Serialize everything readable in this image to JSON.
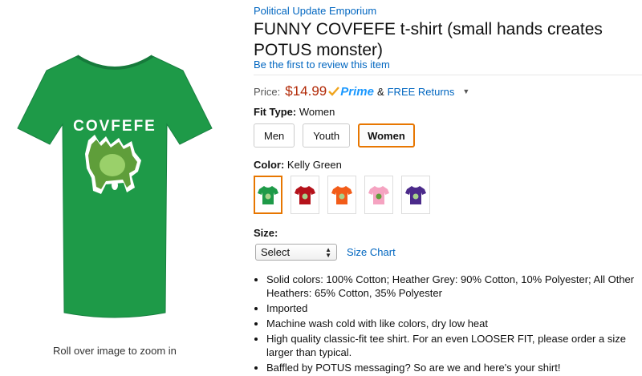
{
  "product": {
    "brand": "Political Update Emporium",
    "title": "FUNNY COVFEFE t-shirt (small hands creates POTUS monster)",
    "review_link": "Be the first to review this item",
    "shirt_text": "COVFEFE",
    "zoom_hint": "Roll over image to zoom in"
  },
  "price": {
    "label": "Price:",
    "value": "$14.99",
    "prime": "Prime",
    "amp": "&",
    "free_returns": "FREE Returns"
  },
  "fit": {
    "label": "Fit Type:",
    "selected": "Women",
    "options": [
      "Men",
      "Youth",
      "Women"
    ]
  },
  "color": {
    "label": "Color:",
    "selected": "Kelly Green",
    "swatches": [
      {
        "name": "Kelly Green",
        "hex": "#1e9a48"
      },
      {
        "name": "Red",
        "hex": "#b5121b"
      },
      {
        "name": "Orange",
        "hex": "#f25c19"
      },
      {
        "name": "Pink",
        "hex": "#f5a3c1"
      },
      {
        "name": "Purple",
        "hex": "#4b2a8a"
      }
    ]
  },
  "size": {
    "label": "Size:",
    "selected": "Select",
    "chart_link": "Size Chart"
  },
  "bullets": [
    "Solid colors: 100% Cotton; Heather Grey: 90% Cotton, 10% Polyester; All Other Heathers: 65% Cotton, 35% Polyester",
    "Imported",
    "Machine wash cold with like colors, dry low heat",
    "High quality classic-fit tee shirt. For an even LOOSER FIT, please order a size larger than typical.",
    "Baffled by POTUS messaging? So are we and here's your shirt!"
  ],
  "colors": {
    "link": "#0066c0",
    "price": "#b12704",
    "prime": "#1a98ff",
    "selected_border": "#e77600",
    "shirt_green": "#1e9a48"
  }
}
